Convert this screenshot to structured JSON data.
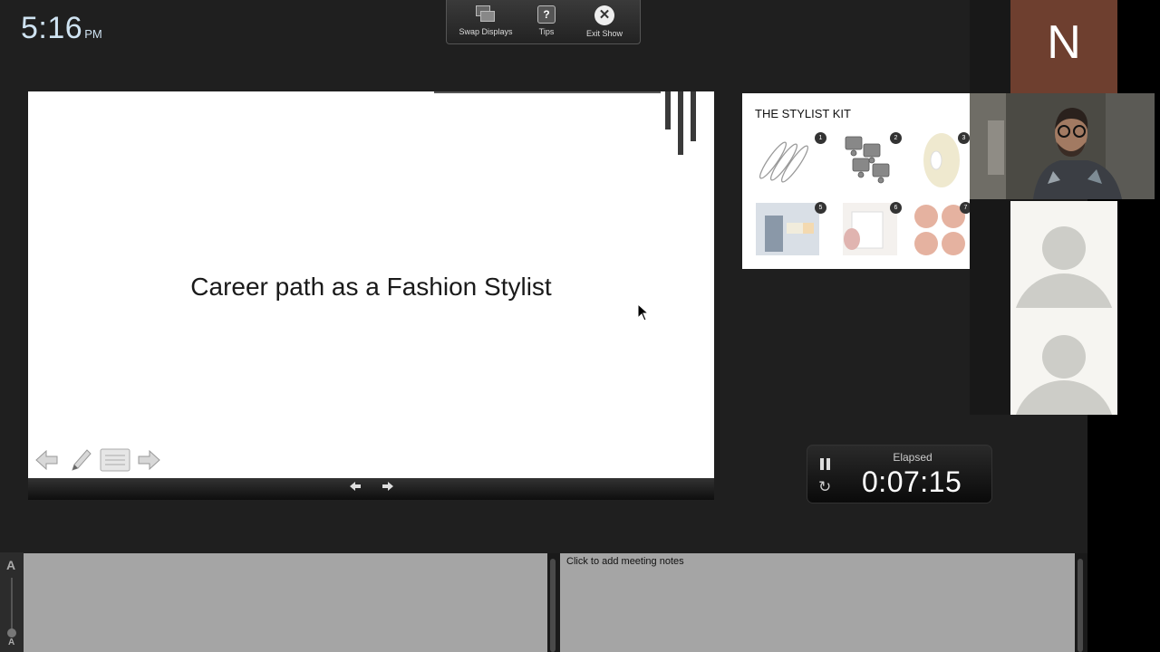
{
  "clock": {
    "time": "5:16",
    "ampm": "PM"
  },
  "toolbar": {
    "swap_label": "Swap Displays",
    "tips_label": "Tips",
    "tips_glyph": "?",
    "exit_label": "Exit Show"
  },
  "current_slide": {
    "title": "Career path as a Fashion Stylist"
  },
  "next_slide": {
    "title": "THE STYLIST KIT",
    "items": [
      {
        "number": "1",
        "icon": "safety-pins-image"
      },
      {
        "number": "2",
        "icon": "clips-image"
      },
      {
        "number": "3",
        "icon": "tape-roll-image"
      },
      {
        "number": "5",
        "icon": "lint-roller-image"
      },
      {
        "number": "6",
        "icon": "tape-sheet-image"
      },
      {
        "number": "7",
        "icon": "nipple-covers-image"
      }
    ]
  },
  "participants": {
    "initial": "N"
  },
  "timer": {
    "label": "Elapsed",
    "value": "0:07:15"
  },
  "notes": {
    "font_large": "A",
    "font_small": "A",
    "meeting_placeholder": "Click to add meeting notes"
  },
  "colors": {
    "background": "#1f1f1f",
    "name_tile": "#6e3f2f",
    "notes_panel": "#a5a5a5",
    "clock_text": "#cfe3f2"
  }
}
